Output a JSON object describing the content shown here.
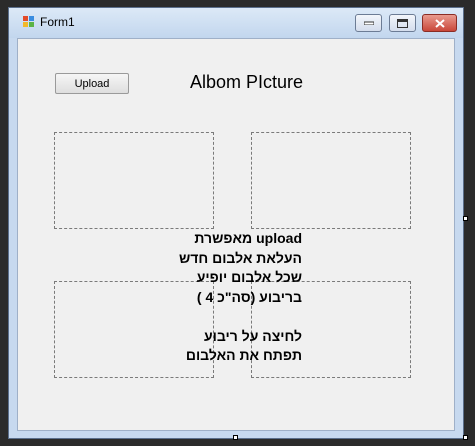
{
  "window": {
    "title": "Form1",
    "icon": "windows-forms-icon",
    "controls": {
      "minimize": "minimize-icon",
      "maximize": "maximize-icon",
      "close": "close-icon"
    }
  },
  "form": {
    "upload_label": "Upload",
    "heading": "Albom PIcture",
    "info_lines": [
      "upload מאפשרת",
      "העלאת אלבום חדש",
      "שכל אלבום יופיע",
      "בריבוע (סה\"כ 4 )",
      "",
      "לחיצה על ריבוע",
      "תפתח את האלבום"
    ]
  }
}
